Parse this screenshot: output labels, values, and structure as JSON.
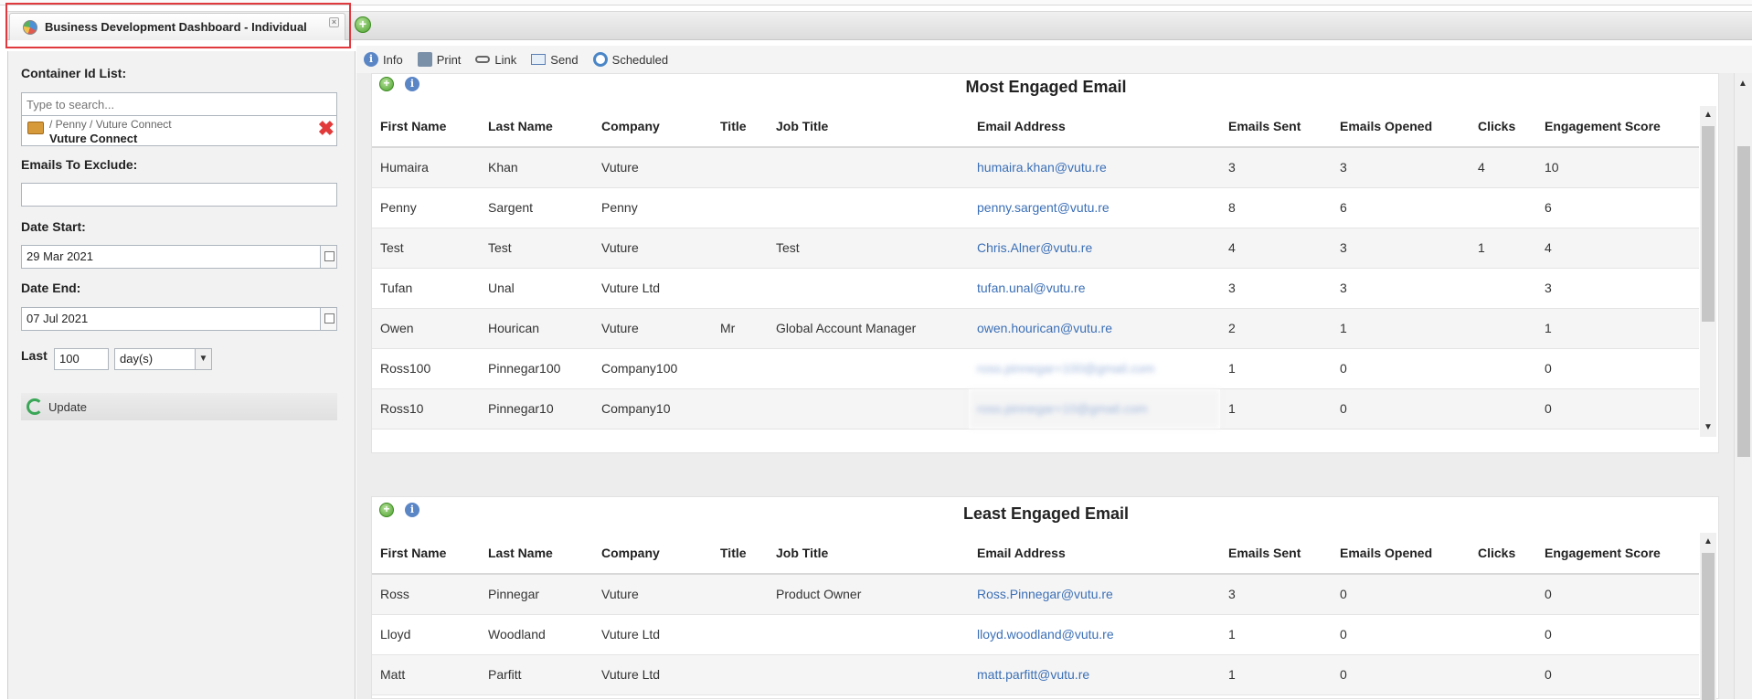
{
  "tab": {
    "title": "Business Development Dashboard - Individual"
  },
  "toolbar": {
    "info": "Info",
    "print": "Print",
    "link": "Link",
    "send": "Send",
    "scheduled": "Scheduled"
  },
  "filters": {
    "container_label": "Container Id List:",
    "search_placeholder": "Type to search...",
    "container_path": "/ Penny / Vuture Connect",
    "container_name": "Vuture Connect",
    "exclude_label": "Emails To Exclude:",
    "exclude_value": "",
    "date_start_label": "Date Start:",
    "date_start": "29 Mar 2021",
    "date_end_label": "Date End:",
    "date_end": "07 Jul 2021",
    "last_label": "Last",
    "last_value": "100",
    "last_unit": "day(s)",
    "update_label": "Update"
  },
  "columns": [
    "First Name",
    "Last Name",
    "Company",
    "Title",
    "Job Title",
    "Email Address",
    "Emails Sent",
    "Emails Opened",
    "Clicks",
    "Engagement Score"
  ],
  "most_engaged": {
    "title": "Most Engaged Email",
    "rows": [
      [
        "Humaira",
        "Khan",
        "Vuture",
        "",
        "",
        "humaira.khan@vutu.re",
        "3",
        "3",
        "4",
        "10"
      ],
      [
        "Penny",
        "Sargent",
        "Penny",
        "",
        "",
        "penny.sargent@vutu.re",
        "8",
        "6",
        "",
        "6"
      ],
      [
        "Test",
        "Test",
        "Vuture",
        "",
        "Test",
        "Chris.Alner@vutu.re",
        "4",
        "3",
        "1",
        "4"
      ],
      [
        "Tufan",
        "Unal",
        "Vuture Ltd",
        "",
        "",
        "tufan.unal@vutu.re",
        "3",
        "3",
        "",
        "3"
      ],
      [
        "Owen",
        "Hourican",
        "Vuture",
        "Mr",
        "Global Account Manager",
        "owen.hourican@vutu.re",
        "2",
        "1",
        "",
        "1"
      ],
      [
        "Ross100",
        "Pinnegar100",
        "Company100",
        "",
        "",
        "ross.pinnegar+100@gmail.com",
        "1",
        "0",
        "",
        "0"
      ],
      [
        "Ross10",
        "Pinnegar10",
        "Company10",
        "",
        "",
        "ross.pinnegar+10@gmail.com",
        "1",
        "0",
        "",
        "0"
      ]
    ]
  },
  "least_engaged": {
    "title": "Least Engaged Email",
    "rows": [
      [
        "Ross",
        "Pinnegar",
        "Vuture",
        "",
        "Product Owner",
        "Ross.Pinnegar@vutu.re",
        "3",
        "0",
        "",
        "0"
      ],
      [
        "Lloyd",
        "Woodland",
        "Vuture Ltd",
        "",
        "",
        "lloyd.woodland@vutu.re",
        "1",
        "0",
        "",
        "0"
      ],
      [
        "Matt",
        "Parfitt",
        "Vuture Ltd",
        "",
        "",
        "matt.parfitt@vutu.re",
        "1",
        "0",
        "",
        "0"
      ]
    ]
  }
}
